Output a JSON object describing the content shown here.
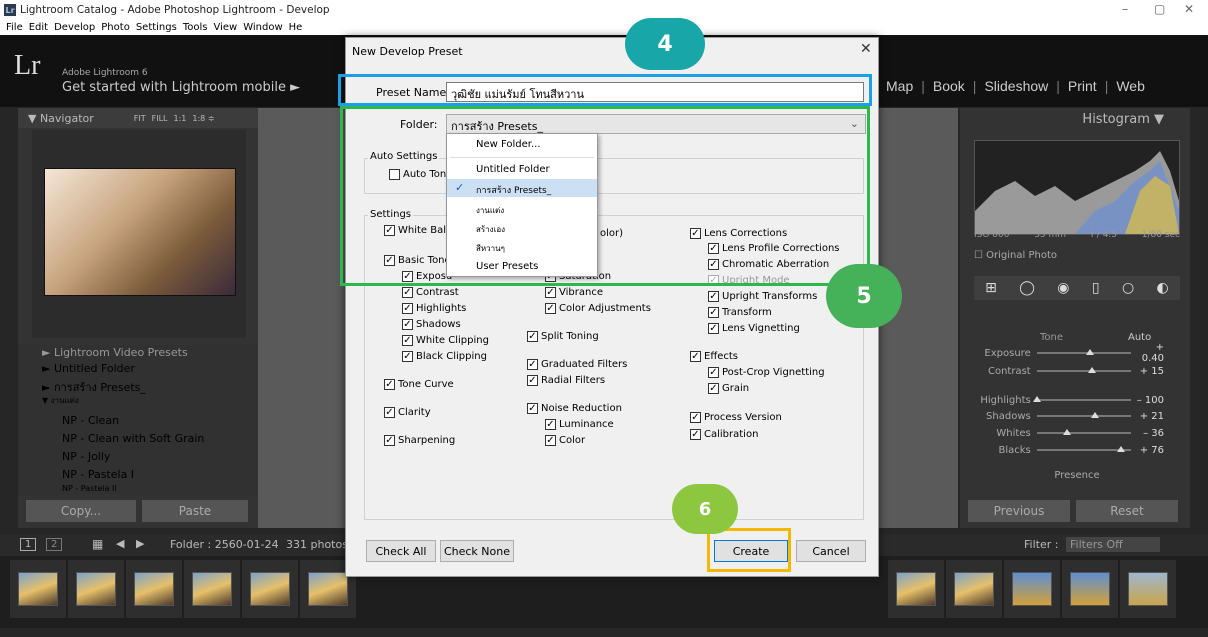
{
  "window": {
    "title": "Lightroom Catalog - Adobe Photoshop Lightroom - Develop",
    "min": "–",
    "max": "▢",
    "close": "✕"
  },
  "menu": [
    "File",
    "Edit",
    "Develop",
    "Photo",
    "Settings",
    "Tools",
    "View",
    "Window",
    "He"
  ],
  "lr": {
    "logo": "Lr",
    "product": "Adobe Lightroom 6",
    "mobile": "Get started with Lightroom mobile ►",
    "modules": [
      "Map",
      "Book",
      "Slideshow",
      "Print",
      "Web"
    ]
  },
  "navigator": {
    "title": "▼ Navigator",
    "zoom": [
      "FIT",
      "FILL",
      "1:1",
      "1:8 ≑"
    ]
  },
  "left_presets": [
    "► Lightroom Video Presets",
    "► Untitled Folder",
    "► การสร้าง Presets_",
    "▼ งานแต่ง",
    "NP - Clean",
    "NP - Clean with Soft Grain",
    "NP - Jolly",
    "NP - Pastela I",
    "NP - Pastela II"
  ],
  "left_buttons": {
    "copy": "Copy...",
    "paste": "Paste"
  },
  "right": {
    "histogram": "Histogram ▼",
    "iso": "ISO 800",
    "focal": "35 mm",
    "aperture": "f / 4.5",
    "shutter": "1/80 sec",
    "original": "☐ Original Photo",
    "tone_label": "Tone",
    "auto": "Auto",
    "sliders": [
      {
        "label": "Exposure",
        "value": "+ 0.40",
        "pos": 0.56
      },
      {
        "label": "Contrast",
        "value": "+ 15",
        "pos": 0.58
      },
      {
        "label": "Highlights",
        "value": "– 100",
        "pos": 0.0
      },
      {
        "label": "Shadows",
        "value": "+ 21",
        "pos": 0.61
      },
      {
        "label": "Whites",
        "value": "– 36",
        "pos": 0.32
      },
      {
        "label": "Blacks",
        "value": "+ 76",
        "pos": 0.88
      }
    ],
    "presence": "Presence",
    "previous": "Previous",
    "reset": "Reset"
  },
  "bottom": {
    "pages": [
      "1",
      "2"
    ],
    "folder": "Folder : 2560-01-24",
    "count": "331 photos",
    "filter_label": "Filter :",
    "filter_value": "Filters Off"
  },
  "dialog": {
    "title": "New Develop Preset",
    "close": "✕",
    "preset_name_label": "Preset Name:",
    "preset_name_value": "วุฒิชัย แม่นรัมย์ โทนสีหวาน",
    "folder_label": "Folder:",
    "folder_value": "การสร้าง Presets_",
    "dropdown": [
      "New Folder...",
      "Untitled Folder",
      "การสร้าง Presets_",
      "งานแต่ง",
      "สร้างเอง",
      "สีหวานๆ",
      "User Presets"
    ],
    "auto_settings": "Auto Settings",
    "auto_tone": "Auto Tone",
    "settings": "Settings",
    "col1": [
      "White Balar",
      "Basic Tone",
      "Exposu",
      "Contrast",
      "Highlights",
      "Shadows",
      "White Clipping",
      "Black Clipping",
      "Tone Curve",
      "Clarity",
      "Sharpening"
    ],
    "col2": [
      "olor)",
      "Saturation",
      "Vibrance",
      "Color Adjustments",
      "Split Toning",
      "Graduated Filters",
      "Radial Filters",
      "Noise Reduction",
      "Luminance",
      "Color"
    ],
    "col3": [
      "Lens Corrections",
      "Lens Profile Corrections",
      "Chromatic Aberration",
      "Upright Mode",
      "Upright Transforms",
      "Transform",
      "Lens Vignetting",
      "Effects",
      "Post-Crop Vignetting",
      "Grain",
      "Process Version",
      "Calibration"
    ],
    "check_all": "Check All",
    "check_none": "Check None",
    "create": "Create",
    "cancel": "Cancel"
  },
  "badges": {
    "b4": "4",
    "b5": "5",
    "b6": "6"
  },
  "colors": {
    "blue": "#1aa0e6",
    "green": "#2db84d",
    "yellow": "#f5b800",
    "teal": "#19a6a8"
  }
}
